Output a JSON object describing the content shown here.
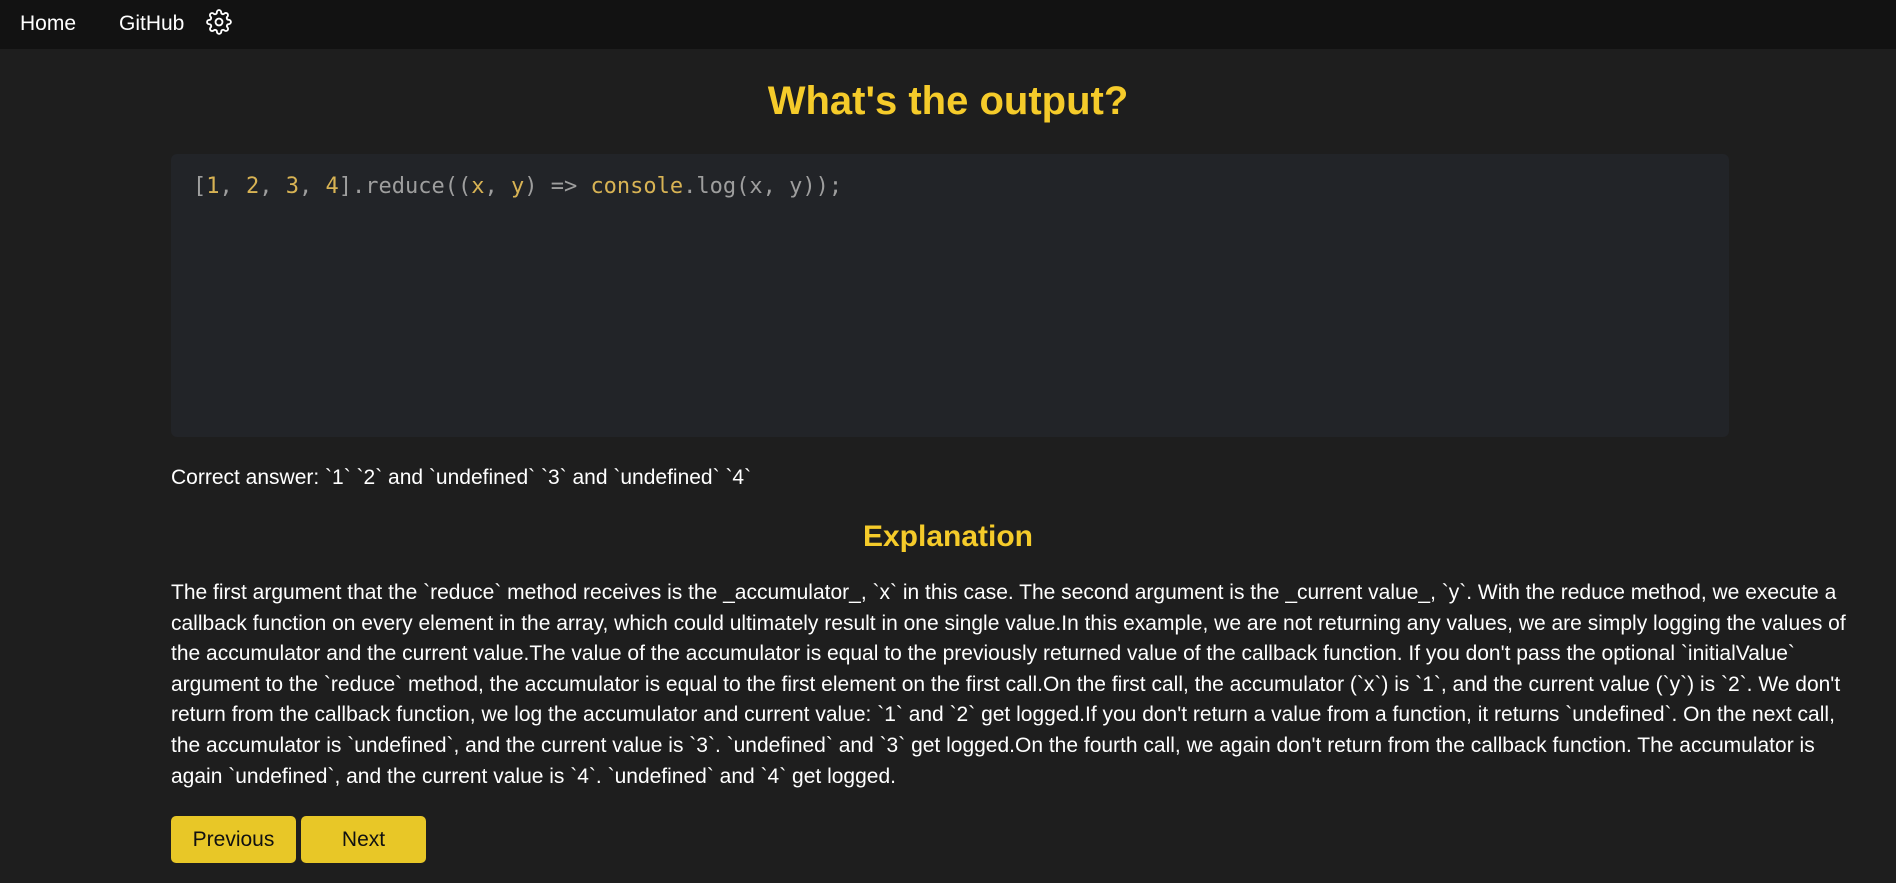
{
  "nav": {
    "home_label": "Home",
    "github_label": "GitHub",
    "settings_icon": "gear-icon"
  },
  "question": {
    "title": "What's the output?",
    "code": {
      "open_bracket": "[",
      "n1": "1",
      "sep1": ", ",
      "n2": "2",
      "sep2": ", ",
      "n3": "3",
      "sep3": ", ",
      "n4": "4",
      "after_array": "].reduce((",
      "param_x": "x",
      "sep4": ", ",
      "param_y": "y",
      "arrow": ") => ",
      "console": "console",
      "log_call": ".log(x, y));"
    }
  },
  "answer": {
    "text": "Correct answer: `1` `2` and `undefined` `3` and `undefined` `4`"
  },
  "explanation": {
    "title": "Explanation",
    "body": "The first argument that the `reduce` method receives is the _accumulator_, `x` in this case. The second argument is the _current value_, `y`. With the reduce method, we execute a callback function on every element in the array, which could ultimately result in one single value.In this example, we are not returning any values, we are simply logging the values of the accumulator and the current value.The value of the accumulator is equal to the previously returned value of the callback function. If you don't pass the optional `initialValue` argument to the `reduce` method, the accumulator is equal to the first element on the first call.On the first call, the accumulator (`x`) is `1`, and the current value (`y`) is `2`. We don't return from the callback function, we log the accumulator and current value: `1` and `2` get logged.If you don't return a value from a function, it returns `undefined`. On the next call, the accumulator is `undefined`, and the current value is `3`. `undefined` and `3` get logged.On the fourth call, we again don't return from the callback function. The accumulator is again `undefined`, and the current value is `4`. `undefined` and `4` get logged."
  },
  "buttons": {
    "previous_label": "Previous",
    "next_label": "Next"
  },
  "colors": {
    "accent": "#f5cb2a",
    "button": "#e8c727",
    "background": "#1e1e1e",
    "nav_background": "#121212",
    "code_background": "#222428"
  }
}
